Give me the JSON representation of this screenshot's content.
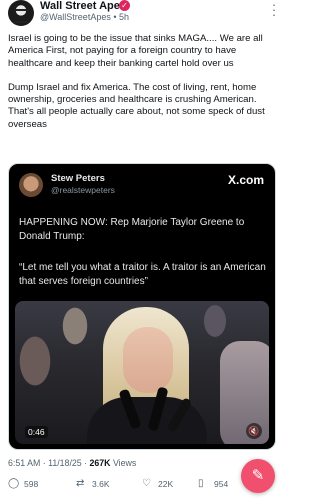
{
  "author": {
    "name": "Wall Street Apes",
    "handle": "@WallStreetApes",
    "time": "5h",
    "separator": " • "
  },
  "post": {
    "paragraph1": "Israel is going to be the issue that sinks MAGA.... We are all America First, not paying for a foreign country to have healthcare and keep their banking cartel hold over us",
    "paragraph2": "Dump Israel and fix America. The cost of living, rent, home ownership, groceries and healthcare is crushing American. That's all people actually care about, not some speck of dust overseas"
  },
  "quoted": {
    "name": "Stew Peters",
    "handle": "@realstewpeters",
    "source": "X.com",
    "headline": "HAPPENING NOW: Rep Marjorie Taylor Greene to Donald Trump:",
    "quote": "“Let me tell you what a traitor is. A traitor is an American that serves foreign countries”",
    "video_time": "0:46"
  },
  "meta": {
    "timestamp": "6:51 AM · 11/18/25 · ",
    "views_count": "267K",
    "views_label": " Views"
  },
  "actions": {
    "replies": "598",
    "reposts": "3.6K",
    "likes": "22K",
    "bookmarks": "954"
  },
  "colors": {
    "verified": "#e0245e",
    "fab": "#f0506e"
  }
}
